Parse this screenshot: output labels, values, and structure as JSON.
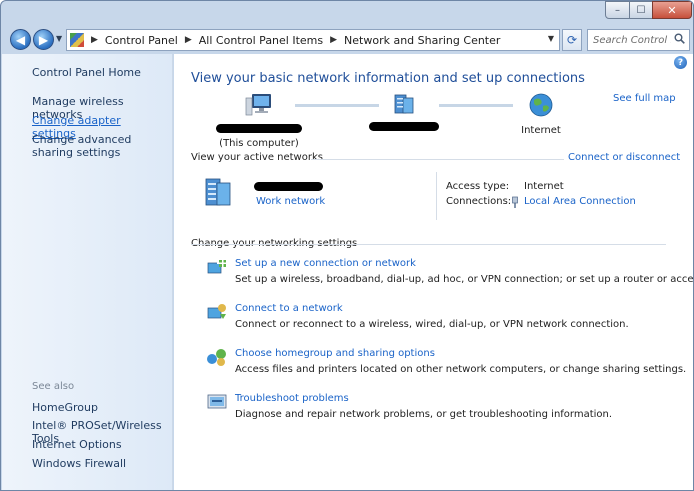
{
  "window": {
    "minimize_glyph": "–",
    "maximize_glyph": "☐",
    "close_glyph": "✕"
  },
  "nav": {
    "back_glyph": "◀",
    "forward_glyph": "▶",
    "breadcrumbs": [
      "Control Panel",
      "All Control Panel Items",
      "Network and Sharing Center"
    ],
    "search_placeholder": "Search Control ..."
  },
  "sidebar": {
    "home": "Control Panel Home",
    "tasks": [
      {
        "label": "Manage wireless networks"
      },
      {
        "label": "Change adapter settings",
        "active": true
      },
      {
        "label": "Change advanced sharing settings"
      }
    ],
    "see_also_label": "See also",
    "see_also": [
      "HomeGroup",
      "Intel® PROSet/Wireless Tools",
      "Internet Options",
      "Windows Firewall"
    ]
  },
  "main": {
    "title": "View your basic network information and set up connections",
    "see_full_map": "See full map",
    "map": {
      "this_computer_label": "(This computer)",
      "internet_label": "Internet"
    },
    "active_networks": {
      "heading": "View your active networks",
      "connect_link": "Connect or disconnect",
      "network_type": "Work network",
      "access_type_label": "Access type:",
      "access_type_value": "Internet",
      "connections_label": "Connections:",
      "connections_value": "Local Area Connection"
    },
    "settings": {
      "heading": "Change your networking settings",
      "tasks": [
        {
          "icon": "new-connection-icon",
          "title": "Set up a new connection or network",
          "desc": "Set up a wireless, broadband, dial-up, ad hoc, or VPN connection; or set up a router or access point."
        },
        {
          "icon": "connect-network-icon",
          "title": "Connect to a network",
          "desc": "Connect or reconnect to a wireless, wired, dial-up, or VPN network connection."
        },
        {
          "icon": "homegroup-icon",
          "title": "Choose homegroup and sharing options",
          "desc": "Access files and printers located on other network computers, or change sharing settings."
        },
        {
          "icon": "troubleshoot-icon",
          "title": "Troubleshoot problems",
          "desc": "Diagnose and repair network problems, or get troubleshooting information."
        }
      ]
    }
  },
  "colors": {
    "link": "#1a63c8",
    "title": "#1f4e99",
    "frame": "#c7d7ea",
    "sidebar": "#e6eff9"
  }
}
